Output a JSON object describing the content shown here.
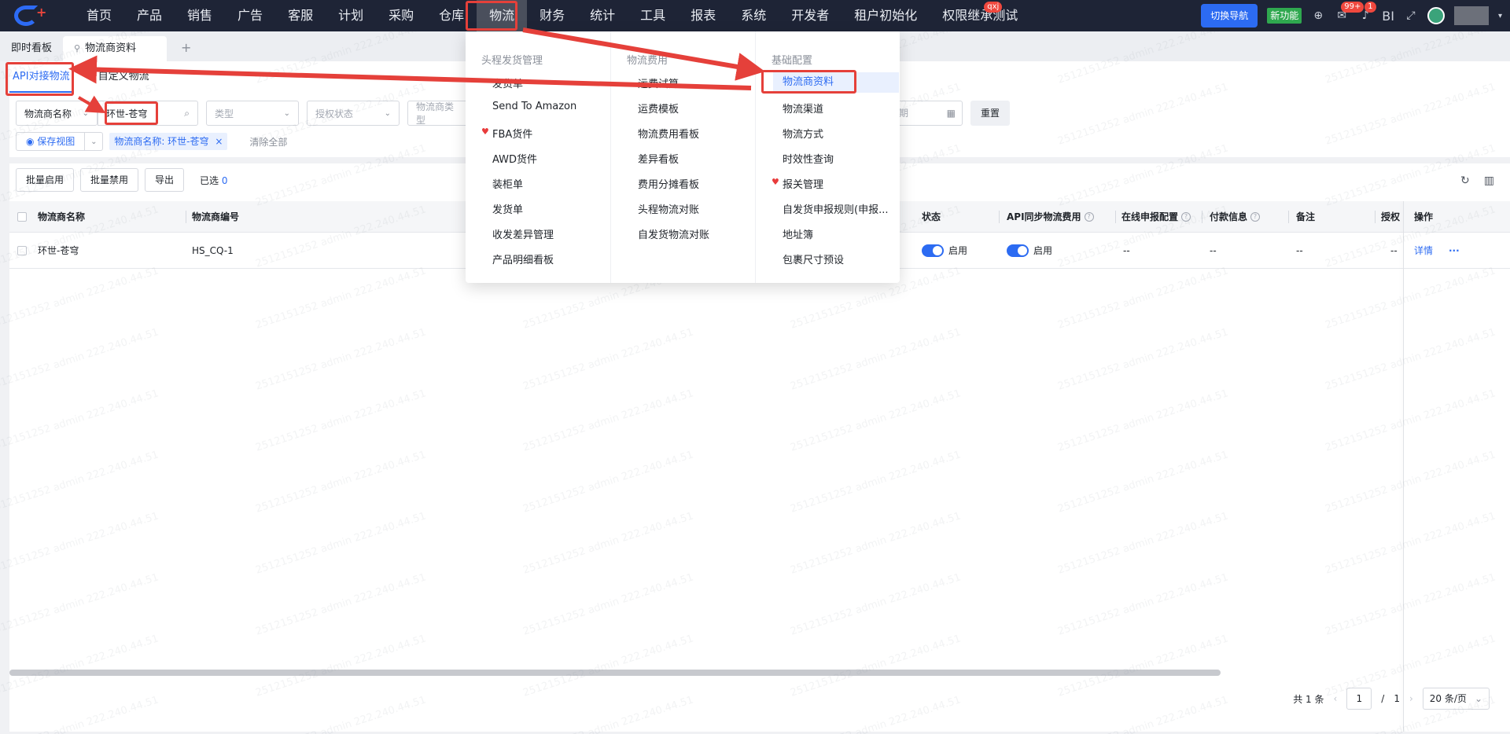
{
  "topbar": {
    "nav": [
      "首页",
      "产品",
      "销售",
      "广告",
      "客服",
      "计划",
      "采购",
      "仓库",
      "物流",
      "财务",
      "统计",
      "工具",
      "报表",
      "系统",
      "开发者",
      "租户初始化",
      "权限继承测试"
    ],
    "active_nav": "物流",
    "nav_badge": "qxj",
    "switch_nav_label": "切换导航",
    "new_feature_label": "新功能",
    "message_badge": "99+",
    "notice_badge": "1",
    "bi_label": "BI"
  },
  "tabs": {
    "items": [
      "即时看板",
      "物流商资料"
    ],
    "add_label": "+"
  },
  "subtabs": [
    "API对接物流",
    "自定义物流"
  ],
  "filters": {
    "field_select": "物流商名称",
    "search_value": "环世-苍穹",
    "type_placeholder": "类型",
    "auth_placeholder": "授权状态",
    "provider_type_placeholder": "物流商类型",
    "date_placeholder": "期",
    "reset_label": "重置"
  },
  "view": {
    "save_view_label": "保存视图",
    "chip_label": "物流商名称: 环世-苍穹",
    "chip_close": "×",
    "clear_all_label": "清除全部"
  },
  "actions": {
    "batch_enable": "批量启用",
    "batch_disable": "批量禁用",
    "export": "导出",
    "selected_label": "已选",
    "selected_count": "0"
  },
  "table": {
    "headers": {
      "name": "物流商名称",
      "code": "物流商编号",
      "status": "状态",
      "api_sync": "API同步物流费用",
      "online_declare": "在线申报配置",
      "payment": "付款信息",
      "remark": "备注",
      "auth": "授权",
      "ops": "操作"
    },
    "rows": [
      {
        "name": "环世-苍穹",
        "code": "HS_CQ-1",
        "status": "启用",
        "api_sync": "启用",
        "online_declare": "--",
        "payment": "--",
        "remark": "--",
        "auth": "--",
        "detail": "详情",
        "more": "···"
      }
    ]
  },
  "pagination": {
    "total": "共 1 条",
    "prev": "‹",
    "current": "1",
    "separator": "/",
    "pages": "1",
    "next": "›",
    "page_size": "20 条/页"
  },
  "menu": {
    "col1": {
      "title": "头程发货管理",
      "items": [
        "发货单",
        "Send To Amazon",
        "FBA货件",
        "AWD货件",
        "装柜单",
        "发货单",
        "收发差异管理",
        "产品明细看板"
      ]
    },
    "col2": {
      "title": "物流费用",
      "items": [
        "运费试算",
        "运费模板",
        "物流费用看板",
        "差异看板",
        "费用分摊看板",
        "头程物流对账",
        "自发货物流对账"
      ]
    },
    "col3": {
      "title": "基础配置",
      "items": [
        "物流商资料",
        "物流渠道",
        "物流方式",
        "时效性查询",
        "报关管理",
        "自发货申报规则(申报...",
        "地址簿",
        "包裹尺寸预设"
      ]
    }
  },
  "watermark": "2512151252 admin 222.240.44.51",
  "colors": {
    "accent": "#2c6bf2",
    "topbar": "#1e2436",
    "annotation": "#e5403a",
    "new_feature": "#2fa84f"
  }
}
